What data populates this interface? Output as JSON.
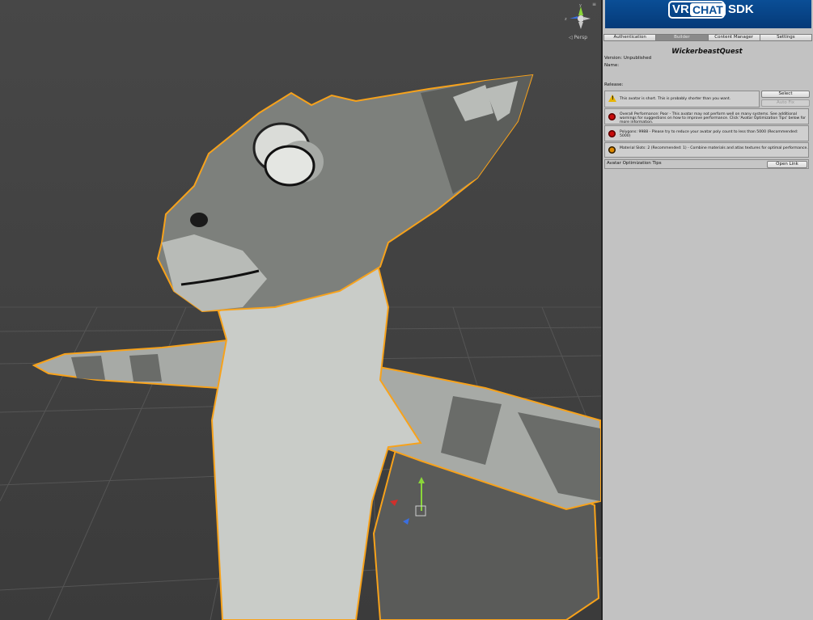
{
  "viewport": {
    "projection_label": "◁ Persp",
    "gizmo_axes": [
      "y",
      "z",
      "x"
    ]
  },
  "sdk": {
    "logo_vr": "VR",
    "logo_chat": "CHAT",
    "logo_sdk": "SDK",
    "tabs": [
      {
        "label": "Authentication",
        "active": false
      },
      {
        "label": "Builder",
        "active": true
      },
      {
        "label": "Content Manager",
        "active": false
      },
      {
        "label": "Settings",
        "active": false
      }
    ],
    "avatar_name": "WickerbeastQuest",
    "version_label": "Version: Unpublished",
    "name_label": "Name:",
    "release_label": "Release:",
    "warning": {
      "icon": "warning-icon",
      "text": "This avatar is short. This is probably shorter than you want.",
      "select_label": "Select",
      "autofix_label": "Auto Fix"
    },
    "messages": [
      {
        "icon": "error-icon",
        "text": "Overall Performance: Poor - This avatar may not perform well on many systems. See additional warnings for suggestions on how to improve performance. Click 'Avatar Optimization Tips' below for more information."
      },
      {
        "icon": "error-icon",
        "text": "Polygons: 9988 - Please try to reduce your avatar poly count to less than 5000 (Recommended: 5000)"
      },
      {
        "icon": "info-icon",
        "text": "Material Slots: 2 (Recommended: 1) - Combine materials and atlas textures for optimal performance."
      }
    ],
    "tips_label": "Avatar Optimization Tips",
    "open_link_label": "Open Link"
  },
  "colors": {
    "banner": "#0a4e96",
    "selection_outline": "#f7a21b",
    "warning": "#e8b400",
    "error": "#c80c0c"
  }
}
